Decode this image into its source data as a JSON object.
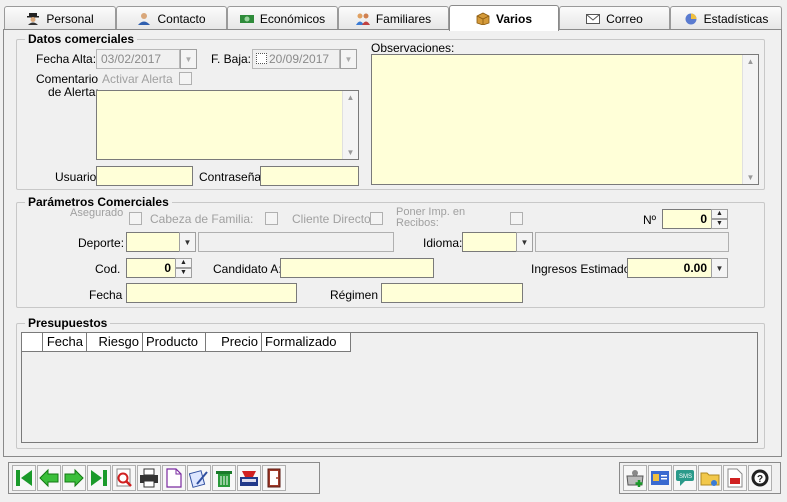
{
  "tabs": [
    {
      "label": "Personal",
      "icon": "person-hat-icon"
    },
    {
      "label": "Contacto",
      "icon": "contact-icon"
    },
    {
      "label": "Económicos",
      "icon": "money-icon"
    },
    {
      "label": "Familiares",
      "icon": "family-icon"
    },
    {
      "label": "Varios",
      "icon": "box-icon",
      "active": true
    },
    {
      "label": "Correo",
      "icon": "envelope-icon"
    },
    {
      "label": "Estadísticas",
      "icon": "pie-chart-icon"
    }
  ],
  "datos_comerciales": {
    "title": "Datos comerciales",
    "fecha_alta_label": "Fecha Alta:",
    "fecha_alta_value": "03/02/2017",
    "fecha_baja_label": "F. Baja:",
    "fecha_baja_value": "20/09/2017",
    "comentario_label_1": "Comentario",
    "comentario_label_2": "de Alerta:",
    "activar_alerta_label": "Activar Alerta",
    "comentario_value": "",
    "usuario_label": "Usuario:",
    "usuario_value": "",
    "contrasena_label": "Contraseña:",
    "contrasena_value": "",
    "observaciones_label": "Observaciones:",
    "observaciones_value": ""
  },
  "parametros": {
    "title": "Parámetros Comerciales",
    "asegurado_label": "Asegurado",
    "cabeza_familia_label": "Cabeza de Familia:",
    "cliente_directo_label": "Cliente Directo:",
    "poner_imp_label": "Poner Imp. en",
    "recibos_label": "Recibos:",
    "numero_label": "Nº",
    "numero_value": "0",
    "deporte_label": "Deporte:",
    "deporte_value": "",
    "deporte_desc": "",
    "idioma_label": "Idioma:",
    "idioma_value": "",
    "idioma_desc": "",
    "cod_label": "Cod.",
    "cod_value": "0",
    "candidato_label": "Candidato A:",
    "candidato_value": "",
    "ingresos_label": "Ingresos Estimados:",
    "ingresos_value": "0.00",
    "fecha_label": "Fecha",
    "fecha_value": "",
    "regimen_label": "Régimen",
    "regimen_value": ""
  },
  "presupuestos": {
    "title": "Presupuestos",
    "columns": [
      "Fecha",
      "Riesgo",
      "Producto",
      "Precio",
      "Formalizado"
    ]
  },
  "toolbar_left": [
    "first-record-icon",
    "previous-record-icon",
    "next-record-icon",
    "last-record-icon",
    "search-document-icon",
    "print-icon",
    "new-document-icon",
    "edit-document-icon",
    "delete-icon",
    "scanner-icon",
    "exit-door-icon"
  ],
  "toolbar_right": [
    "add-contact-icon",
    "card-icon",
    "sms-icon",
    "folder-icon",
    "pdf-icon",
    "help-icon"
  ],
  "colors": {
    "field_bg": "#ffffd8",
    "window_bg": "#f0f0f0"
  }
}
